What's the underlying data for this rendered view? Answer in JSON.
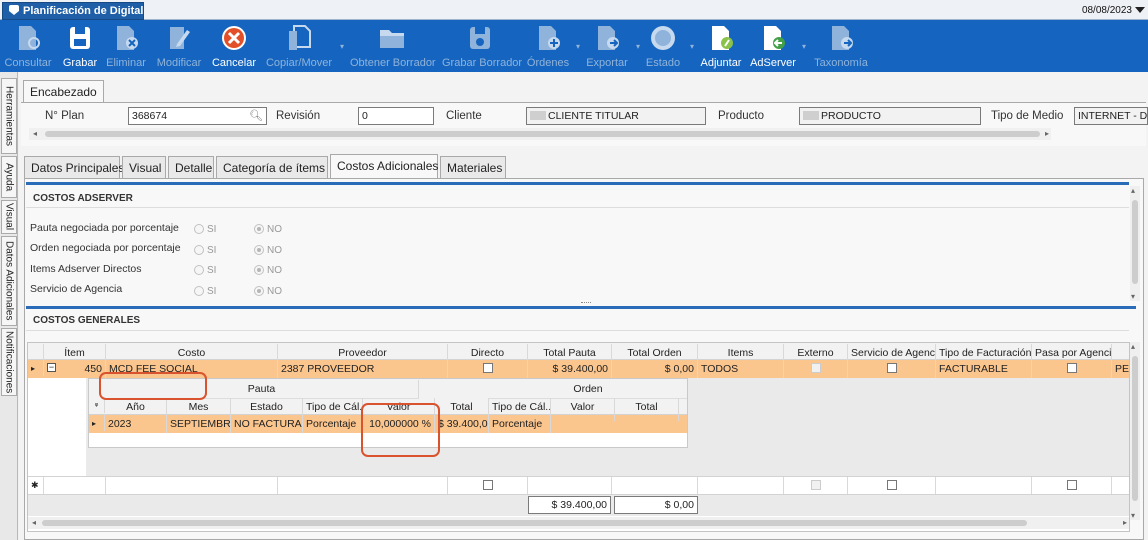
{
  "window": {
    "tab_title": "Planificación de Digital",
    "date": "08/08/2023"
  },
  "toolbar": [
    {
      "id": "consultar",
      "label": "Consultar",
      "icon": "consultar-icon",
      "enabled": false
    },
    {
      "id": "grabar",
      "label": "Grabar",
      "icon": "save-icon",
      "enabled": true
    },
    {
      "id": "eliminar",
      "label": "Eliminar",
      "icon": "delete-icon",
      "enabled": false
    },
    {
      "id": "modificar",
      "label": "Modificar",
      "icon": "edit-icon",
      "enabled": false
    },
    {
      "id": "cancelar",
      "label": "Cancelar",
      "icon": "cancel-icon",
      "enabled": true
    },
    {
      "id": "copiar",
      "label": "Copiar/Mover",
      "icon": "copy-icon",
      "enabled": false
    },
    {
      "id": "obtener",
      "label": "Obtener Borrador",
      "icon": "folder-icon",
      "enabled": false
    },
    {
      "id": "grabarborrador",
      "label": "Grabar Borrador",
      "icon": "save-draft-icon",
      "enabled": false
    },
    {
      "id": "ordenes",
      "label": "Órdenes",
      "icon": "orders-icon",
      "enabled": false
    },
    {
      "id": "exportar",
      "label": "Exportar",
      "icon": "export-icon",
      "enabled": false
    },
    {
      "id": "estado",
      "label": "Estado",
      "icon": "status-icon",
      "enabled": false
    },
    {
      "id": "adjuntar",
      "label": "Adjuntar",
      "icon": "attach-icon",
      "enabled": true
    },
    {
      "id": "adserver",
      "label": "AdServer",
      "icon": "adserver-icon",
      "enabled": true
    },
    {
      "id": "taxonomia",
      "label": "Taxonomía",
      "icon": "taxonomy-icon",
      "enabled": false
    }
  ],
  "side_tabs": [
    "Herramientas",
    "Ayuda",
    "Visual",
    "Datos Adicionales",
    "Notificaciones"
  ],
  "header": {
    "tab": "Encabezado",
    "plan_label": "N° Plan",
    "plan_value": "368674",
    "revision_label": "Revisión",
    "revision_value": "0",
    "cliente_label": "Cliente",
    "cliente_value": "CLIENTE TITULAR",
    "producto_label": "Producto",
    "producto_value": "PRODUCTO",
    "medio_label": "Tipo de Medio",
    "medio_value": "INTERNET - DIGI"
  },
  "tabs": [
    "Datos Principales",
    "Visual",
    "Detalle",
    "Categoría de ítems",
    "Costos Adicionales",
    "Materiales"
  ],
  "active_tab": "Costos Adicionales",
  "adserver": {
    "title": "COSTOS ADSERVER",
    "si": "SI",
    "no": "NO",
    "rows": [
      "Pauta negociada por porcentaje",
      "Orden negociada por porcentaje",
      "Items Adserver Directos",
      "Servicio de Agencia"
    ]
  },
  "generales": {
    "title": "COSTOS GENERALES",
    "columns": [
      "Ítem",
      "Costo",
      "Proveedor",
      "Directo",
      "Total Pauta",
      "Total Orden",
      "Items",
      "Externo",
      "Servicio de Agencia",
      "Tipo de Facturación",
      "Pasa por Agencia"
    ],
    "row": {
      "item": "450",
      "costo": "MCD FEE SOCIAL",
      "proveedor": "2387 PROVEEDOR",
      "total_pauta": "$ 39.400,00",
      "total_orden": "$ 0,00",
      "items": "TODOS",
      "tipo_facturacion": "FACTURABLE",
      "extra": "PES"
    },
    "sub": {
      "pauta_label": "Pauta",
      "orden_label": "Orden",
      "columns": [
        "Año",
        "Mes",
        "Estado",
        "Tipo de Cál...",
        "Valor",
        "Total",
        "Tipo de Cál...",
        "Valor",
        "Total"
      ],
      "row": [
        "2023",
        "SEPTIEMBRE",
        "NO FACTURADO",
        "Porcentaje",
        "10,000000 %",
        "$ 39.400,00",
        "Porcentaje",
        "",
        ""
      ]
    },
    "totals": {
      "pauta": "$ 39.400,00",
      "orden": "$ 0,00"
    }
  },
  "colors": {
    "toolbar": "#1565c0",
    "highlight_row": "#fbc58e",
    "annotation": "#d9532e"
  }
}
